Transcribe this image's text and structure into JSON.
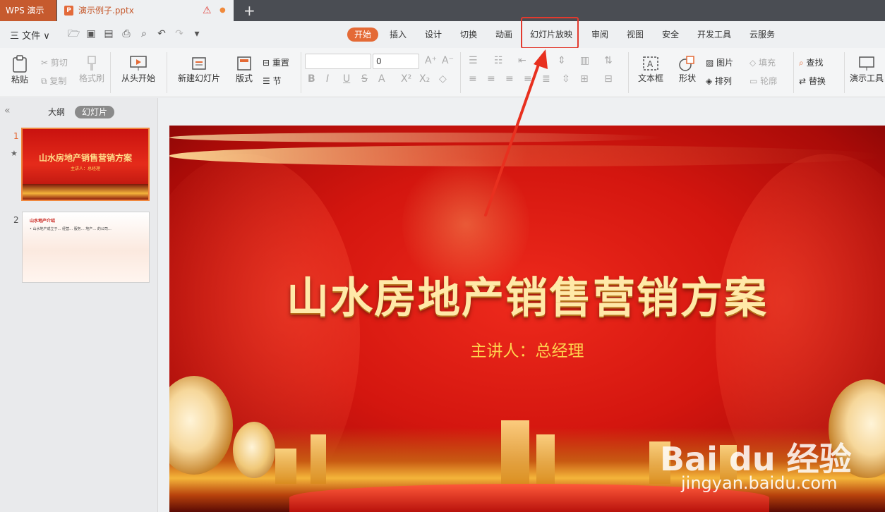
{
  "titlebar": {
    "app_tab": "WPS 演示",
    "doc_icon": "P",
    "doc_name": "演示例子.pptx",
    "new_tab": "+"
  },
  "menubar": {
    "file": "三 文件 ∨",
    "tabs": [
      "开始",
      "插入",
      "设计",
      "切换",
      "动画",
      "幻灯片放映",
      "审阅",
      "视图",
      "安全",
      "开发工具",
      "云服务"
    ],
    "active_tab": "开始"
  },
  "ribbon": {
    "paste": "粘贴",
    "cut": "剪切",
    "copy": "复制",
    "format_painter": "格式刷",
    "from_start": "从头开始",
    "new_slide": "新建幻灯片",
    "layout": "版式",
    "reset": "重置",
    "section": "节",
    "font_size": "0",
    "textbox": "文本框",
    "shape": "形状",
    "picture": "图片",
    "arrange": "排列",
    "fill": "填充",
    "outline": "轮廓",
    "find": "查找",
    "replace": "替换",
    "presentation_tools": "演示工具"
  },
  "panel": {
    "tab_outline": "大纲",
    "tab_slides": "幻灯片",
    "slides": [
      {
        "num": "1",
        "title": "山水房地产销售营销方案",
        "sub": "主讲人：总经理"
      },
      {
        "num": "2",
        "title": "山水地产介绍",
        "line": "• 山水地产成立于… 经营… 服务… 地产… 的公司…"
      }
    ]
  },
  "slide": {
    "title": "山水房地产销售营销方案",
    "subtitle": "主讲人：总经理"
  },
  "watermark": {
    "text": "Bai du 经验",
    "url": "jingyan.baidu.com"
  },
  "colors": {
    "accent": "#e46a36",
    "highlight": "#e23a2e",
    "titlebar": "#4a4d53"
  }
}
